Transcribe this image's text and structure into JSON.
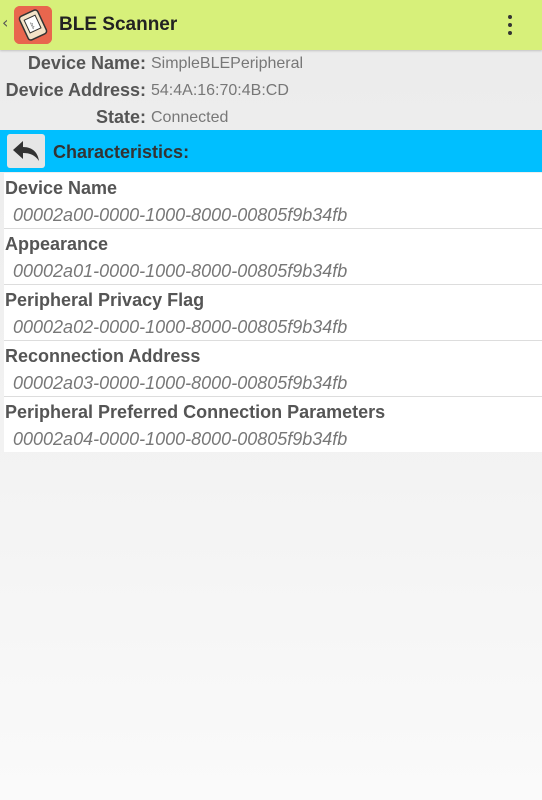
{
  "app": {
    "title": "BLE Scanner",
    "icon": "ble-scanner-app-icon",
    "accent_color": "#d7f07a"
  },
  "device": {
    "name_label": "Device Name:",
    "name_value": "SimpleBLEPeripheral",
    "address_label": "Device Address:",
    "address_value": "54:4A:16:70:4B:CD",
    "state_label": "State:",
    "state_value": "Connected"
  },
  "characteristics": {
    "header": "Characteristics:",
    "header_color": "#00bfff",
    "items": [
      {
        "name": "Device Name",
        "uuid": "00002a00-0000-1000-8000-00805f9b34fb"
      },
      {
        "name": "Appearance",
        "uuid": "00002a01-0000-1000-8000-00805f9b34fb"
      },
      {
        "name": "Peripheral Privacy Flag",
        "uuid": "00002a02-0000-1000-8000-00805f9b34fb"
      },
      {
        "name": "Reconnection Address",
        "uuid": "00002a03-0000-1000-8000-00805f9b34fb"
      },
      {
        "name": "Peripheral Preferred Connection Parameters",
        "uuid": "00002a04-0000-1000-8000-00805f9b34fb"
      }
    ]
  }
}
